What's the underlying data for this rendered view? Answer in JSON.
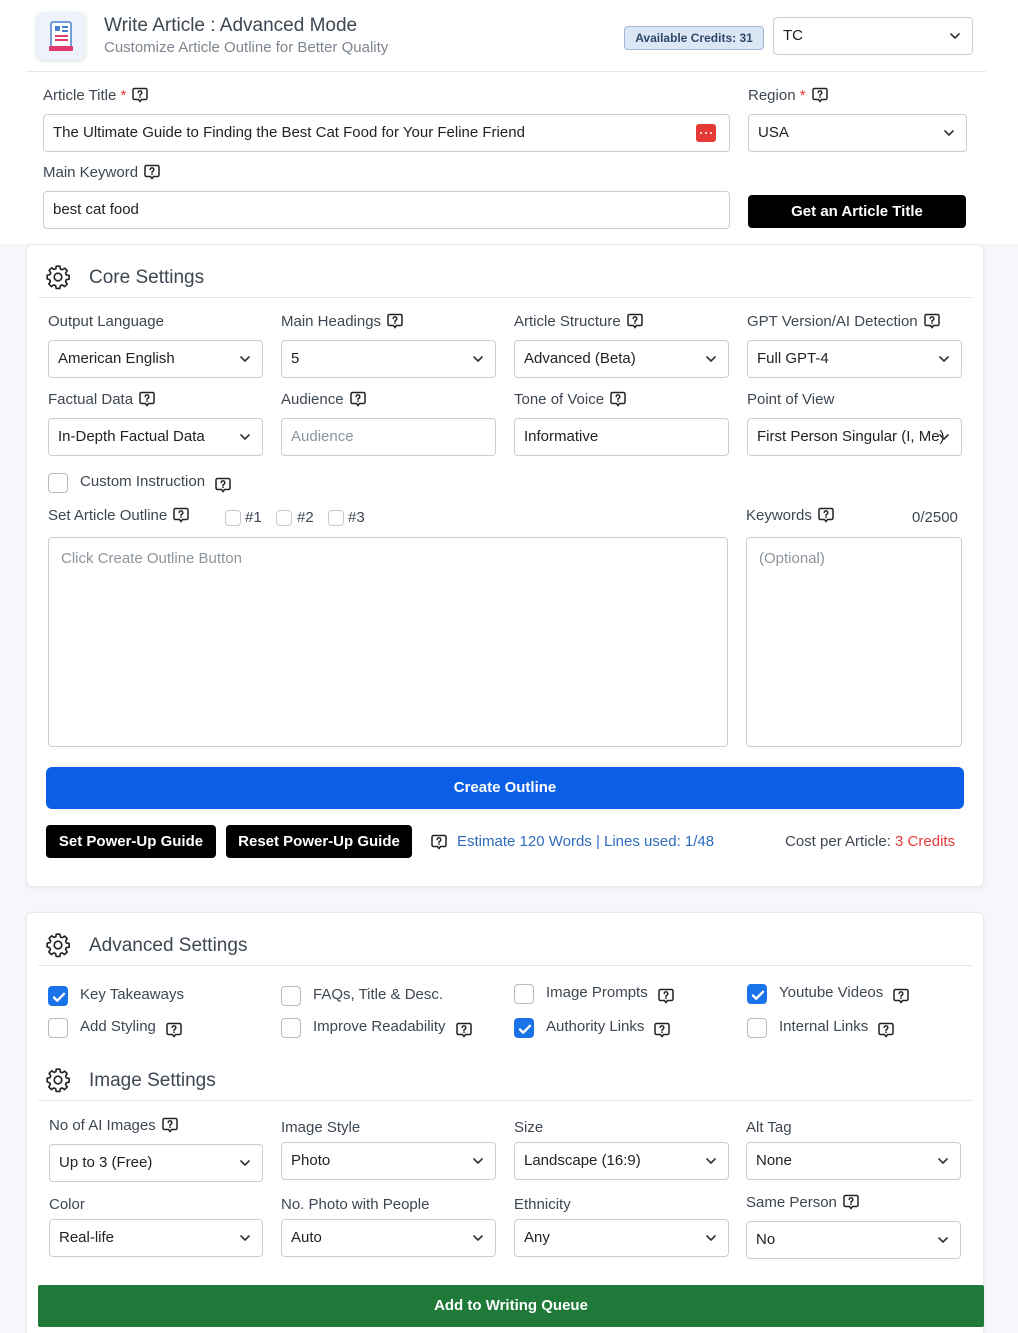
{
  "header": {
    "title": "Write Article : Advanced Mode",
    "subtitle": "Customize Article Outline for Better Quality",
    "credits_badge": "Available Credits: 31",
    "account_select": "TC"
  },
  "article": {
    "title_label": "Article Title",
    "title_value": "The Ultimate Guide to Finding the Best Cat Food for Your Feline Friend",
    "region_label": "Region",
    "region_value": "USA",
    "keyword_label": "Main Keyword",
    "keyword_value": "best cat food",
    "get_title_button": "Get an Article Title",
    "required_mark": "*"
  },
  "core": {
    "section_title": "Core Settings",
    "output_language_label": "Output Language",
    "output_language_value": "American English",
    "main_headings_label": "Main Headings",
    "main_headings_value": "5",
    "structure_label": "Article Structure",
    "structure_value": "Advanced (Beta)",
    "gpt_label": "GPT Version/AI Detection",
    "gpt_value": "Full GPT-4",
    "factual_label": "Factual Data",
    "factual_value": "In-Depth Factual Data",
    "audience_label": "Audience",
    "audience_placeholder": "Audience",
    "tone_label": "Tone of Voice",
    "tone_value": "Informative",
    "pov_label": "Point of View",
    "pov_value": "First Person Singular (I, Me)",
    "custom_instruction_label": "Custom Instruction",
    "outline_label": "Set Article Outline",
    "outline_options": [
      "#1",
      "#2",
      "#3"
    ],
    "outline_placeholder": "Click Create Outline Button",
    "keywords_label": "Keywords",
    "keywords_count": "0/2500",
    "keywords_placeholder": "(Optional)",
    "create_outline_button": "Create Outline",
    "set_powerup_button": "Set Power-Up Guide",
    "reset_powerup_button": "Reset Power-Up Guide",
    "estimate_text": "Estimate 120 Words | Lines used: 1/48",
    "cost_label": "Cost per Article:",
    "cost_value": "3 Credits"
  },
  "advanced": {
    "section_title": "Advanced Settings",
    "options": [
      {
        "label": "Key Takeaways",
        "checked": true
      },
      {
        "label": "FAQs, Title & Desc.",
        "checked": false
      },
      {
        "label": "Image Prompts",
        "checked": false
      },
      {
        "label": "Youtube Videos",
        "checked": true
      },
      {
        "label": "Add Styling",
        "checked": false
      },
      {
        "label": "Improve Readability",
        "checked": false
      },
      {
        "label": "Authority Links",
        "checked": true
      },
      {
        "label": "Internal Links",
        "checked": false
      }
    ]
  },
  "image": {
    "section_title": "Image Settings",
    "num_images_label": "No of AI Images",
    "num_images_value": "Up to 3 (Free)",
    "style_label": "Image Style",
    "style_value": "Photo",
    "size_label": "Size",
    "size_value": "Landscape (16:9)",
    "alt_label": "Alt Tag",
    "alt_value": "None",
    "color_label": "Color",
    "color_value": "Real-life",
    "people_label": "No. Photo with People",
    "people_value": "Auto",
    "ethnicity_label": "Ethnicity",
    "ethnicity_value": "Any",
    "same_person_label": "Same Person",
    "same_person_value": "No"
  },
  "footer": {
    "queue_button": "Add to Writing Queue"
  },
  "colors": {
    "primary_blue": "#0b5fe6",
    "queue_green": "#1f7a3a",
    "checkbox_blue": "#1a73e8",
    "required_red": "#e53935"
  }
}
